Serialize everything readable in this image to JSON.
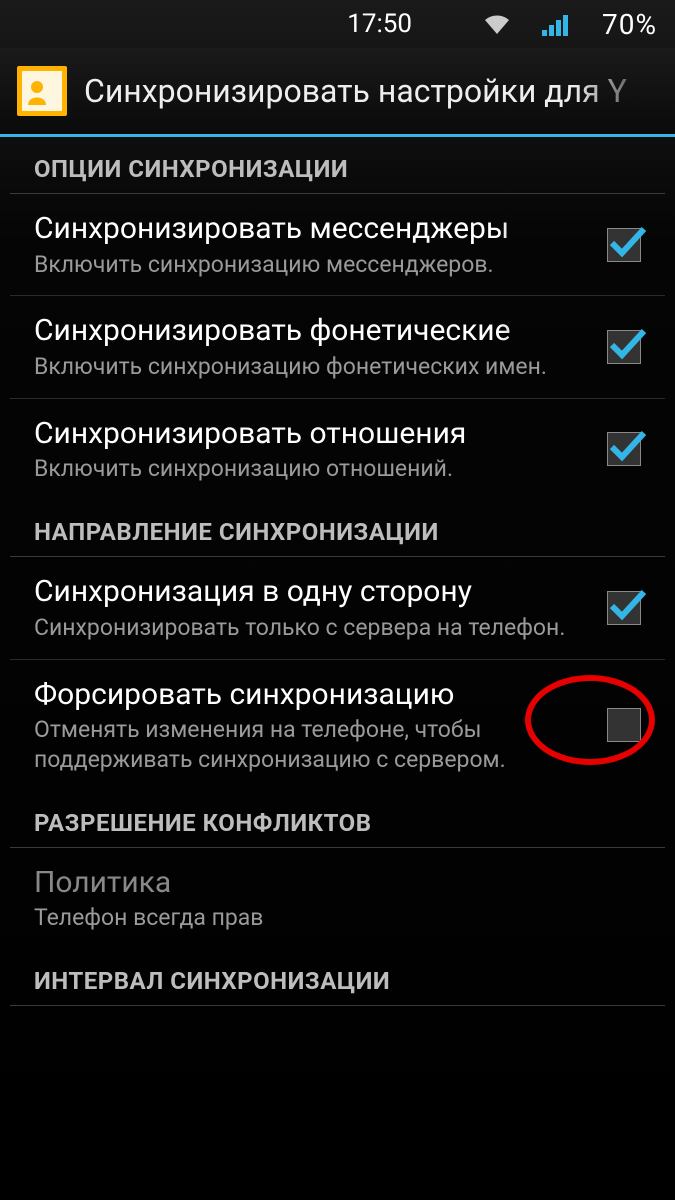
{
  "status": {
    "time": "17:50",
    "battery": "70%"
  },
  "actionbar": {
    "title": "Синхронизировать настройки для Y"
  },
  "sections": {
    "sync_options": "ОПЦИИ СИНХРОНИЗАЦИИ",
    "sync_direction": "НАПРАВЛЕНИЕ СИНХРОНИЗАЦИИ",
    "conflict_res": "РАЗРЕШЕНИЕ КОНФЛИКТОВ",
    "sync_interval": "ИНТЕРВАЛ СИНХРОНИЗАЦИИ"
  },
  "items": {
    "messengers": {
      "title": "Синхронизировать мессенджеры",
      "sub": "Включить синхронизацию мессенджеров.",
      "checked": true
    },
    "phonetic": {
      "title": "Синхронизировать фонетические",
      "sub": "Включить синхронизацию фонетических имен.",
      "checked": true
    },
    "relations": {
      "title": "Синхронизировать отношения",
      "sub": "Включить синхронизацию отношений.",
      "checked": true
    },
    "one_way": {
      "title": "Синхронизация в одну сторону",
      "sub": "Синхронизировать только с сервера на телефон.",
      "checked": true
    },
    "force_sync": {
      "title": "Форсировать синхронизацию",
      "sub": "Отменять изменения на телефоне, чтобы поддерживать синхронизацию с сервером.",
      "checked": false
    },
    "policy": {
      "title": "Политика",
      "sub": "Телефон всегда прав",
      "enabled": false
    }
  }
}
